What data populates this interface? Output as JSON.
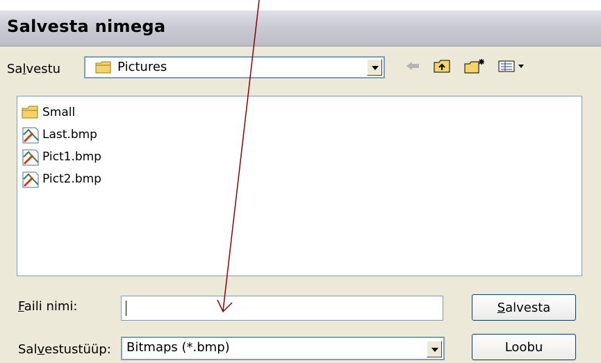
{
  "window": {
    "title": "Salvesta nimega"
  },
  "save_in": {
    "label_pre": "Sa",
    "label_accel": "l",
    "label_post": "vestu",
    "value": "Pictures"
  },
  "toolbar": {
    "back_icon": "back-arrow-icon",
    "up_icon": "up-folder-icon",
    "new_folder_icon": "new-folder-icon",
    "view_icon": "view-menu-icon"
  },
  "files": [
    {
      "name": "Small",
      "icon": "folder-icon"
    },
    {
      "name": "Last.bmp",
      "icon": "bitmap-icon"
    },
    {
      "name": "Pict1.bmp",
      "icon": "bitmap-icon"
    },
    {
      "name": "Pict2.bmp",
      "icon": "bitmap-icon"
    }
  ],
  "filename": {
    "label_accel": "F",
    "label_rest": "aili nimi:",
    "value": ""
  },
  "filetype": {
    "label_pre": "Sal",
    "label_accel": "v",
    "label_post": "estustüüp:",
    "value": "Bitmaps (*.bmp)"
  },
  "buttons": {
    "save_accel": "S",
    "save_rest": "alvesta",
    "cancel": "Loobu"
  },
  "colors": {
    "arrow": "#8b0000",
    "folder": "#f3d36b",
    "window_bg": "#ece9d8",
    "border": "#7f9db9"
  }
}
